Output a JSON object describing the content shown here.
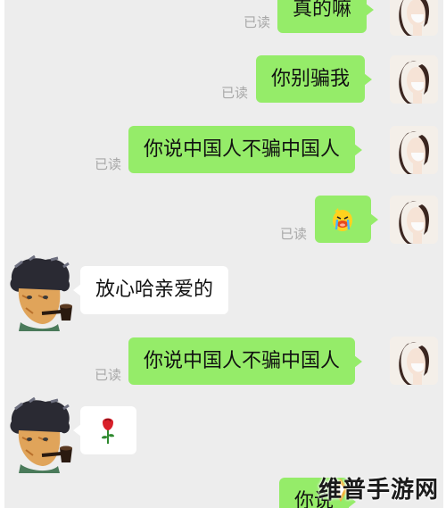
{
  "chat": {
    "messages": [
      {
        "side": "me",
        "text": "真的嘛",
        "status": "已读"
      },
      {
        "side": "me",
        "text": "你别骗我",
        "status": "已读"
      },
      {
        "side": "me",
        "text": "你说中国人不骗中国人",
        "status": "已读"
      },
      {
        "side": "me",
        "sticker": "crying-duck-emoji",
        "status": "已读"
      },
      {
        "side": "them",
        "text": "放心哈亲爱的"
      },
      {
        "side": "me",
        "text": "你说中国人不骗中国人",
        "status": "已读"
      },
      {
        "side": "them",
        "sticker": "rose-emoji"
      },
      {
        "side": "me",
        "text": "你说"
      }
    ]
  },
  "watermark": {
    "text": "维普手游网"
  },
  "colors": {
    "background": "#ededed",
    "my_bubble": "#95ec69",
    "their_bubble": "#ffffff",
    "read_text": "#a8a8a8"
  }
}
